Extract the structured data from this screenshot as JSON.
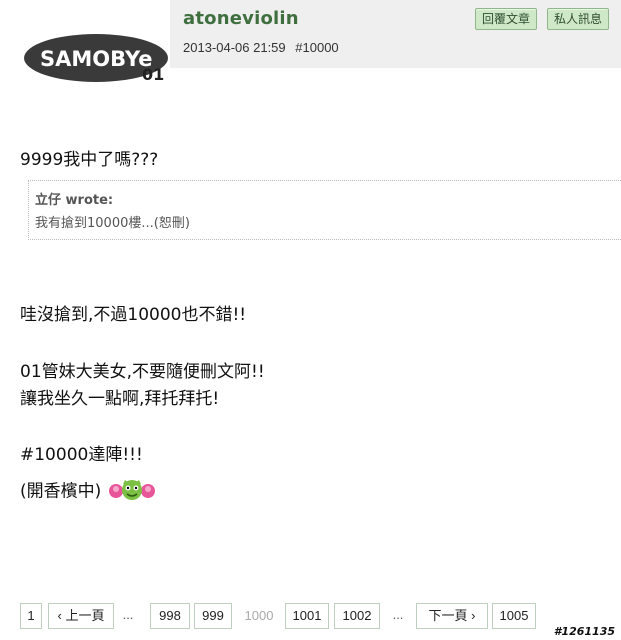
{
  "post": {
    "username": "atoneviolin",
    "datetime": "2013-04-06 21:59",
    "post_number": "#10000",
    "avatar_text": "SAMOBYe",
    "avatar_sub": "01",
    "buttons": {
      "reply": "回覆文章",
      "pm": "私人訊息"
    },
    "line1": "9999我中了嗎???",
    "quote": {
      "author": "立仔 wrote:",
      "text": "我有搶到10000樓...(恕刪)"
    },
    "paragraphs": [
      "哇沒搶到,不過10000也不錯!!",
      "01管妹大美女,不要隨便刪文阿!!",
      "讓我坐久一點啊,拜托拜托!",
      "#10000達陣!!!",
      "(開香檳中)"
    ],
    "emoticon": "celebration-emoticon"
  },
  "pager": {
    "items": [
      "1",
      "‹ 上一頁",
      "...",
      "998",
      "999",
      "1000",
      "1001",
      "1002",
      "...",
      "下一頁 ›",
      "1005"
    ],
    "current": "1000"
  },
  "footer": {
    "post_id": "#1261135"
  },
  "colors": {
    "username": "#3f6f3f",
    "button_bg": "#cfe8c8",
    "header_bg": "#efefef"
  }
}
